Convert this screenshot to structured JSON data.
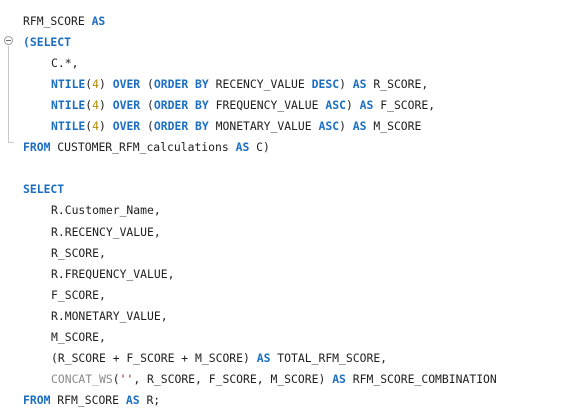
{
  "editor": {
    "language": "sql",
    "colors": {
      "keyword": "#1b6ec2",
      "number": "#b38a00",
      "string": "#a31515",
      "text": "#1e1e1e",
      "muted_function": "#8a8a8a"
    },
    "fold_icon": "minus-circle-icon",
    "lines": [
      {
        "tokens": [
          {
            "t": "id",
            "v": "RFM_SCORE "
          },
          {
            "t": "kw",
            "v": "AS"
          }
        ]
      },
      {
        "tokens": [
          {
            "t": "kw",
            "v": "(SELECT"
          }
        ]
      },
      {
        "indent": true,
        "tokens": [
          {
            "t": "id",
            "v": "C.*,"
          }
        ]
      },
      {
        "indent": true,
        "tokens": [
          {
            "t": "kw",
            "v": "NTILE"
          },
          {
            "t": "id",
            "v": "("
          },
          {
            "t": "num",
            "v": "4"
          },
          {
            "t": "id",
            "v": ") "
          },
          {
            "t": "kw",
            "v": "OVER"
          },
          {
            "t": "id",
            "v": " ("
          },
          {
            "t": "kw",
            "v": "ORDER BY"
          },
          {
            "t": "id",
            "v": " RECENCY_VALUE "
          },
          {
            "t": "kw",
            "v": "DESC"
          },
          {
            "t": "id",
            "v": ") "
          },
          {
            "t": "kw",
            "v": "AS"
          },
          {
            "t": "id",
            "v": " R_SCORE,"
          }
        ]
      },
      {
        "indent": true,
        "tokens": [
          {
            "t": "kw",
            "v": "NTILE"
          },
          {
            "t": "id",
            "v": "("
          },
          {
            "t": "num",
            "v": "4"
          },
          {
            "t": "id",
            "v": ") "
          },
          {
            "t": "kw",
            "v": "OVER"
          },
          {
            "t": "id",
            "v": " ("
          },
          {
            "t": "kw",
            "v": "ORDER BY"
          },
          {
            "t": "id",
            "v": " FREQUENCY_VALUE "
          },
          {
            "t": "kw",
            "v": "ASC"
          },
          {
            "t": "id",
            "v": ") "
          },
          {
            "t": "kw",
            "v": "AS"
          },
          {
            "t": "id",
            "v": " F_SCORE,"
          }
        ]
      },
      {
        "indent": true,
        "tokens": [
          {
            "t": "kw",
            "v": "NTILE"
          },
          {
            "t": "id",
            "v": "("
          },
          {
            "t": "num",
            "v": "4"
          },
          {
            "t": "id",
            "v": ") "
          },
          {
            "t": "kw",
            "v": "OVER"
          },
          {
            "t": "id",
            "v": " ("
          },
          {
            "t": "kw",
            "v": "ORDER BY"
          },
          {
            "t": "id",
            "v": " MONETARY_VALUE "
          },
          {
            "t": "kw",
            "v": "ASC"
          },
          {
            "t": "id",
            "v": ") "
          },
          {
            "t": "kw",
            "v": "AS"
          },
          {
            "t": "id",
            "v": " M_SCORE"
          }
        ]
      },
      {
        "tokens": [
          {
            "t": "kw",
            "v": "FROM"
          },
          {
            "t": "id",
            "v": " CUSTOMER_RFM_calculations "
          },
          {
            "t": "kw",
            "v": "AS"
          },
          {
            "t": "id",
            "v": " C)"
          }
        ]
      },
      {
        "tokens": []
      },
      {
        "tokens": [
          {
            "t": "kw",
            "v": "SELECT"
          }
        ]
      },
      {
        "indent": true,
        "tokens": [
          {
            "t": "id",
            "v": "R.Customer_Name,"
          }
        ]
      },
      {
        "indent": true,
        "tokens": [
          {
            "t": "id",
            "v": "R.RECENCY_VALUE,"
          }
        ]
      },
      {
        "indent": true,
        "tokens": [
          {
            "t": "id",
            "v": "R_SCORE,"
          }
        ]
      },
      {
        "indent": true,
        "tokens": [
          {
            "t": "id",
            "v": "R.FREQUENCY_VALUE,"
          }
        ]
      },
      {
        "indent": true,
        "tokens": [
          {
            "t": "id",
            "v": "F_SCORE,"
          }
        ]
      },
      {
        "indent": true,
        "tokens": [
          {
            "t": "id",
            "v": "R.MONETARY_VALUE,"
          }
        ]
      },
      {
        "indent": true,
        "tokens": [
          {
            "t": "id",
            "v": "M_SCORE,"
          }
        ]
      },
      {
        "indent": true,
        "tokens": [
          {
            "t": "id",
            "v": "(R_SCORE + F_SCORE + M_SCORE) "
          },
          {
            "t": "kw",
            "v": "AS"
          },
          {
            "t": "id",
            "v": " TOTAL_RFM_SCORE,"
          }
        ]
      },
      {
        "indent": true,
        "tokens": [
          {
            "t": "dim",
            "v": "CONCAT_WS"
          },
          {
            "t": "id",
            "v": "("
          },
          {
            "t": "str",
            "v": "''"
          },
          {
            "t": "id",
            "v": ", R_SCORE, F_SCORE, M_SCORE) "
          },
          {
            "t": "kw",
            "v": "AS"
          },
          {
            "t": "id",
            "v": " RFM_SCORE_COMBINATION"
          }
        ]
      },
      {
        "tokens": [
          {
            "t": "kw",
            "v": "FROM"
          },
          {
            "t": "id",
            "v": " RFM_SCORE "
          },
          {
            "t": "kw",
            "v": "AS"
          },
          {
            "t": "id",
            "v": " R;"
          }
        ]
      }
    ]
  }
}
